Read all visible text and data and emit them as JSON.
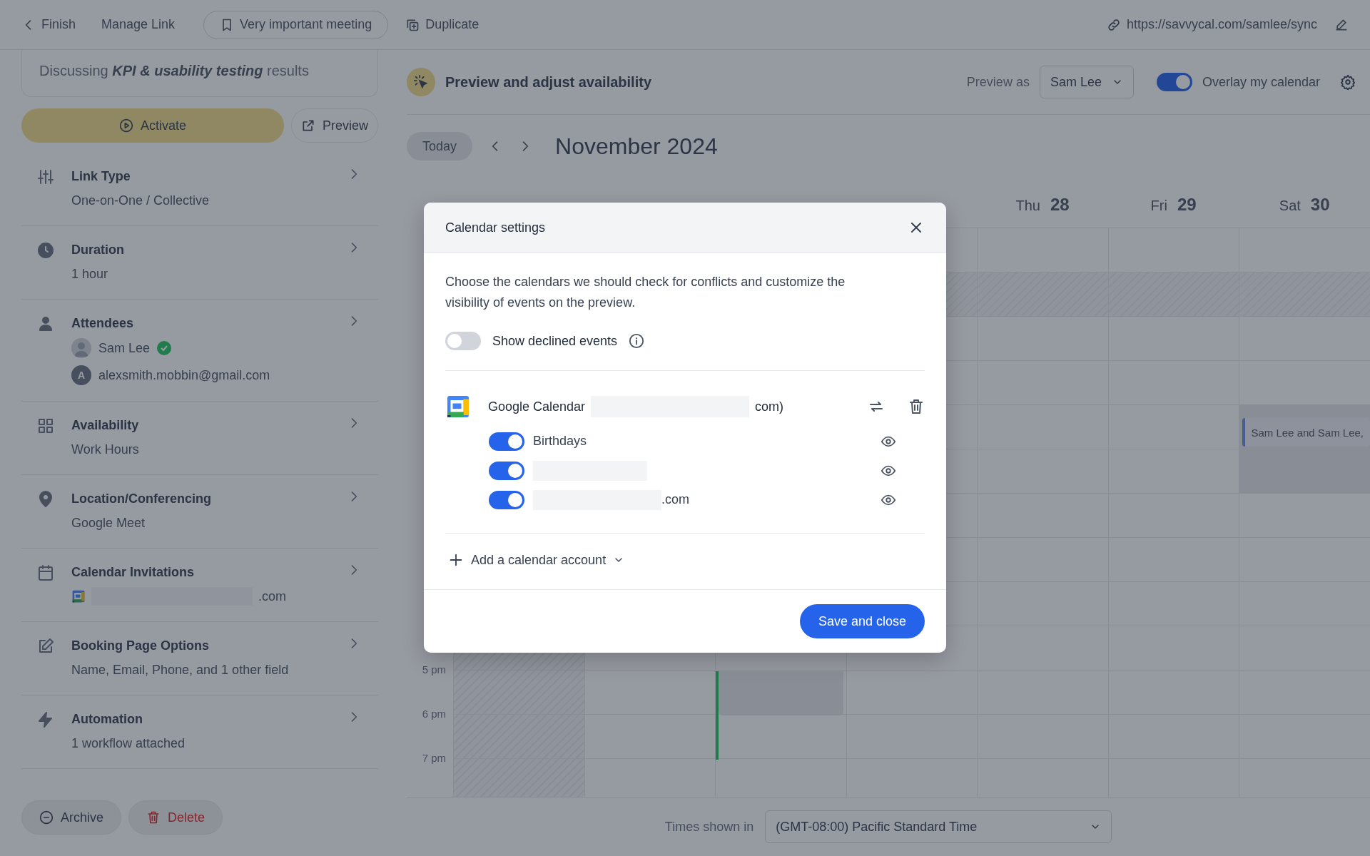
{
  "top_bar": {
    "back": "Finish",
    "manage_link": "Manage Link",
    "meeting_tag": "Very important meeting",
    "duplicate": "Duplicate",
    "url": "https://savvycal.com/samlee/sync"
  },
  "link_card": {
    "description": "Discussing **KPI & usability testing** results"
  },
  "actions": {
    "activate": "Activate",
    "preview": "Preview"
  },
  "settings": [
    {
      "kind": "text",
      "title": "Link Type",
      "value": "One-on-One / Collective"
    },
    {
      "kind": "text",
      "title": "Duration",
      "value": "1 hour"
    },
    {
      "kind": "attendees",
      "title": "Attendees",
      "attendees": [
        {
          "name": "Sam Lee",
          "verified": true
        },
        {
          "name": "alexsmith.mobbin@gmail.com",
          "initial": "A",
          "verified": false
        }
      ]
    },
    {
      "kind": "text",
      "title": "Availability",
      "value": "Work Hours"
    },
    {
      "kind": "text",
      "title": "Location/Conferencing",
      "value": "Google Meet"
    },
    {
      "kind": "account",
      "title": "Calendar Invitations",
      "value": ".com",
      "redacted": true
    },
    {
      "kind": "text",
      "title": "Booking Page Options",
      "value": "Name, Email, Phone, and 1 other field"
    },
    {
      "kind": "text",
      "title": "Automation",
      "value": "1 workflow attached"
    }
  ],
  "footer_actions": {
    "archive": "Archive",
    "delete": "Delete"
  },
  "preview": {
    "title": "Preview and adjust availability",
    "preview_as_label": "Preview as",
    "preview_as": "Sam Lee",
    "overlay": {
      "label": "Overlay my calendar",
      "on": true
    }
  },
  "calendar": {
    "today": "Today",
    "month": "November 2024",
    "days": [
      {
        "unavailable": true
      },
      {
        "unavailable": false
      },
      {
        "unavailable": false
      },
      {
        "unavailable": false
      },
      {
        "name": "Thu",
        "date": "28",
        "unavailable": false
      },
      {
        "name": "Fri",
        "date": "29",
        "unavailable": false
      },
      {
        "name": "Sat",
        "date": "30",
        "unavailable": false,
        "events": [
          {
            "title": "Sam Lee and Sam Lee,"
          }
        ]
      }
    ],
    "hours": [
      {
        "label": "5 pm"
      },
      {
        "label": "6 pm"
      },
      {
        "label": "7 pm"
      }
    ]
  },
  "timezone": {
    "label": "Times shown in",
    "value": "(GMT-08:00) Pacific Standard Time"
  },
  "modal": {
    "title": "Calendar settings",
    "intro": "Choose the calendars we should check for conflicts and customize the visibility of events on the preview.",
    "show_declined": {
      "label": "Show declined events",
      "on": false
    },
    "account": {
      "name": "Google Calendar",
      "redacted": true,
      "suffix": "com)",
      "calendars": [
        {
          "name": "Birthdays",
          "on": true,
          "redacted": false
        },
        {
          "on": true,
          "redacted": true
        },
        {
          "suffix": ".com",
          "on": true,
          "redacted": true
        }
      ]
    },
    "add_account": "Add a calendar account",
    "save": "Save and close"
  }
}
